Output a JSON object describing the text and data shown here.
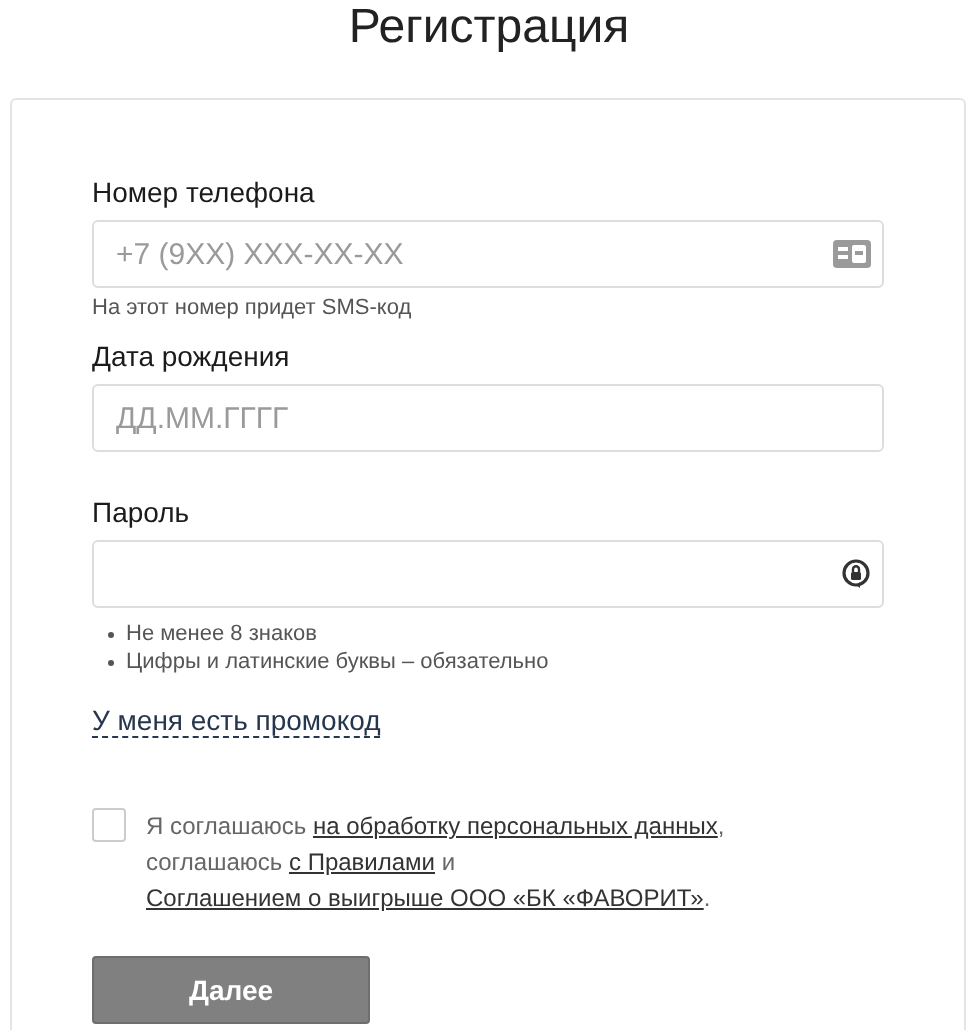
{
  "title": "Регистрация",
  "fields": [
    {
      "label": "Номер телефона",
      "placeholder": "+7 (9XX) XXX-XX-XX",
      "kind": "phone",
      "hint": "На этот номер придет SMS-код"
    },
    {
      "label": "Дата рождения",
      "placeholder": "ДД.ММ.ГГГГ",
      "kind": "date"
    },
    {
      "label": "Пароль",
      "kind": "password",
      "rules": [
        "Не менее 8 знаков",
        "Цифры и латинские буквы – обязательно"
      ]
    }
  ],
  "promo_link": "У меня есть промокод",
  "agreement": {
    "checked": false,
    "parts": [
      {
        "kind": "text",
        "text": "Я соглашаюсь "
      },
      {
        "kind": "link",
        "text": "на обработку персональных данных"
      },
      {
        "kind": "text",
        "text": ", соглашаюсь "
      },
      {
        "kind": "link",
        "text": "с Правилами"
      },
      {
        "kind": "text",
        "text": " и "
      },
      {
        "kind": "link",
        "text": "Соглашением о выигрыше ООО «БК «ФАВОРИТ»"
      },
      {
        "kind": "text",
        "text": "."
      }
    ]
  },
  "submit": {
    "label": "Далее",
    "disabled": true
  }
}
